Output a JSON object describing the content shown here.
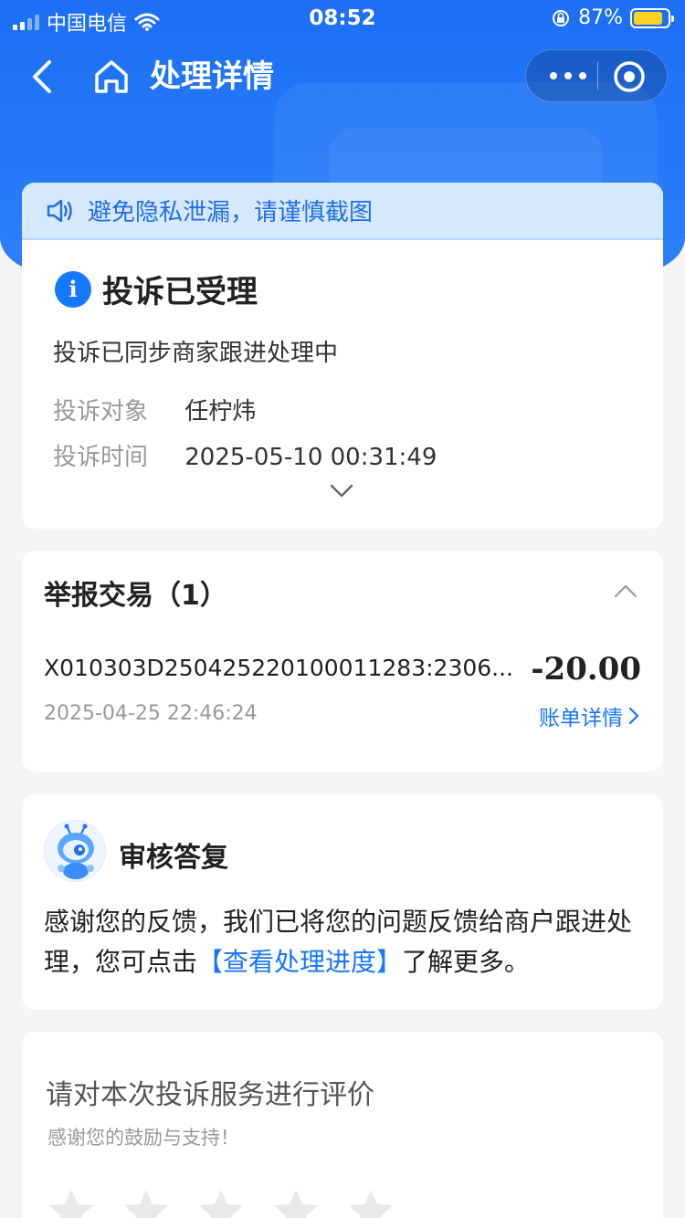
{
  "status_bar": {
    "carrier": "中国电信",
    "time": "08:52",
    "battery": "87%",
    "battery_level": 0.87
  },
  "nav": {
    "title": "处理详情"
  },
  "notice": {
    "text": "避免隐私泄漏，请谨慎截图",
    "icon": "speaker-icon"
  },
  "complaint": {
    "status_title": "投诉已受理",
    "status_desc": "投诉已同步商家跟进处理中",
    "target_label": "投诉对象",
    "target_value": "任柠炜",
    "time_label": "投诉时间",
    "time_value": "2025-05-10 00:31:49"
  },
  "transactions": {
    "title": "举报交易（1）",
    "items": [
      {
        "id": "X010303D250425220100011283:2306...",
        "amount": "-20.00",
        "date": "2025-04-25 22:46:24",
        "link": "账单详情"
      }
    ]
  },
  "review": {
    "title": "审核答复",
    "body_before": "感谢您的反馈，我们已将您的问题反馈给商户跟进处理，您可点击",
    "body_link": "【查看处理进度】",
    "body_after": "了解更多。"
  },
  "rating": {
    "title": "请对本次投诉服务进行评价",
    "subtitle": "感谢您的鼓励与支持！",
    "stars_total": 5,
    "stars_selected": 0
  },
  "colors": {
    "brand_blue": "#1677ff",
    "header_blue": "#1b6ff5",
    "notice_bg": "#d6e8fd",
    "battery_yellow": "#ffd21f"
  }
}
